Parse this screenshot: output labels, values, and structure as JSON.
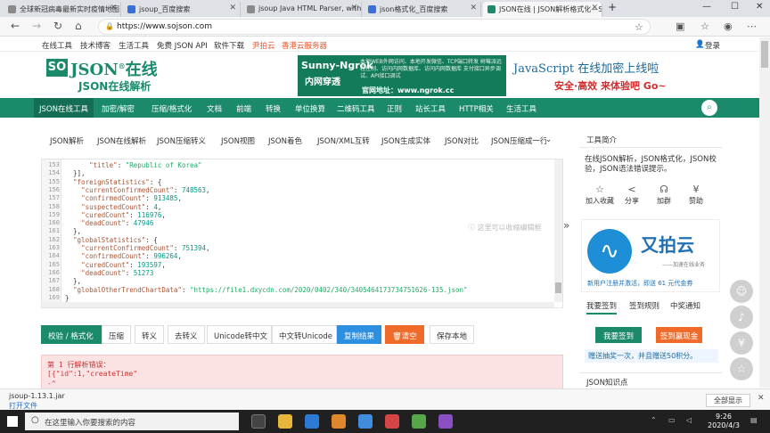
{
  "browser": {
    "tabs": [
      {
        "label": "全球新冠病毒最新实时疫情地图",
        "active": false
      },
      {
        "label": "jsoup_百度搜索",
        "active": false
      },
      {
        "label": "jsoup Java HTML Parser, with the",
        "active": false
      },
      {
        "label": "json格式化_百度搜索",
        "active": false
      },
      {
        "label": "JSON在线 | JSON解析格式化—S",
        "active": true
      }
    ],
    "new_tab": "+",
    "url": "https://www.sojson.com"
  },
  "topmenu": {
    "items": [
      "在线工具",
      "技术博客",
      "生活工具",
      "免费 JSON API",
      "软件下载"
    ],
    "highlight_items": [
      "尹拍云",
      "香港云服务器"
    ],
    "login": "登录"
  },
  "header": {
    "logo_so": "SO",
    "logo_json": "JSON",
    "logo_reg": "®",
    "logo_zx": "在线",
    "logo_sub": "JSON在线解析",
    "ad1_title": "Sunny-Ngrok",
    "ad1_sub": "内网穿透",
    "ad1_desc": "本地WEB外网访问、本地开发微信、TCP端口转发 树莓派远程控制、访问内网数据库、访问内网数据库 支付接口异步调试、API接口调试",
    "ad1_url": "官网地址：www.ngrok.cc",
    "ad2_title": "JavaScript 在线加密上线啦",
    "ad2_sub": "安全·高效 来体验吧 Go~"
  },
  "mainnav": {
    "items": [
      "JSON在线工具",
      "加密/解密",
      "压缩/格式化",
      "文档",
      "前端",
      "转换",
      "单位换算",
      "二维码工具",
      "正则",
      "站长工具",
      "HTTP相关",
      "生活工具"
    ]
  },
  "subtabs": [
    "JSON解析",
    "JSON在线解析",
    "JSON压缩转义",
    "JSON视图",
    "JSON着色",
    "JSON/XML互转",
    "JSON生成实体",
    "JSON对比",
    "JSON压缩成一行"
  ],
  "editor": {
    "lines": [
      {
        "n": "153",
        "t": "      \"title\": \"Republic of Korea\""
      },
      {
        "n": "154",
        "t": "  }],"
      },
      {
        "n": "155",
        "t": "  \"foreignStatistics\": {"
      },
      {
        "n": "156",
        "t": "    \"currentConfirmedCount\": 748563,"
      },
      {
        "n": "157",
        "t": "    \"confirmedCount\": 913485,"
      },
      {
        "n": "158",
        "t": "    \"suspectedCount\": 4,"
      },
      {
        "n": "159",
        "t": "    \"curedCount\": 116976,"
      },
      {
        "n": "160",
        "t": "    \"deadCount\": 47946"
      },
      {
        "n": "161",
        "t": "  },"
      },
      {
        "n": "162",
        "t": "  \"globalStatistics\": {"
      },
      {
        "n": "163",
        "t": "    \"currentConfirmedCount\": 751394,"
      },
      {
        "n": "164",
        "t": "    \"confirmedCount\": 996264,"
      },
      {
        "n": "165",
        "t": "    \"curedCount\": 193597,"
      },
      {
        "n": "166",
        "t": "    \"deadCount\": 51273"
      },
      {
        "n": "167",
        "t": "  },"
      },
      {
        "n": "168",
        "t": "  \"globalOtherTrendChartData\": \"https://file1.dxycdn.com/2020/0402/340/3405464173734751626-135.json\""
      },
      {
        "n": "169",
        "t": "}"
      }
    ],
    "hint": "这里可以收缩编辑框"
  },
  "buttons": {
    "format": "校验 / 格式化",
    "compress": "压缩",
    "escape": "转义",
    "unescape": "去转义",
    "unicode_cn": "Unicode转中文",
    "cn_unicode": "中文转Unicode",
    "copy": "复制结果",
    "clear": "清空",
    "save": "保存本地"
  },
  "error": {
    "line1": "第 1 行解析错误：",
    "line2": "[{\"id\":1,\"createTime\"",
    "line3": "-^"
  },
  "sidebar": {
    "title": "工具简介",
    "desc": "在线JSON解析，JSON格式化，JSON校验，JSON语法错误提示。",
    "actions": [
      {
        "icon": "☆",
        "label": "加入收藏"
      },
      {
        "icon": "<",
        "label": "分享"
      },
      {
        "icon": "☊",
        "label": "加群"
      },
      {
        "icon": "¥",
        "label": "赞助"
      }
    ],
    "ad_title": "又拍云",
    "ad_slogan": "——加速在线业务",
    "ad_offer": "新用户注册并激活，即送 61 元代金券",
    "tabs": [
      "我要签到",
      "签到规则",
      "中奖通知"
    ],
    "sign_btn": "我要签到",
    "draw_btn": "签到赢现金",
    "note": "赠送抽奖一次，并且赠送50积分。",
    "knowledge": "JSON知识点"
  },
  "download": {
    "file": "jsoup-1.13.1.jar",
    "open": "打开文件",
    "show_all": "全部显示"
  },
  "taskbar": {
    "search_placeholder": "在这里输入你要搜索的内容",
    "time": "9:26",
    "date": "2020/4/3"
  }
}
